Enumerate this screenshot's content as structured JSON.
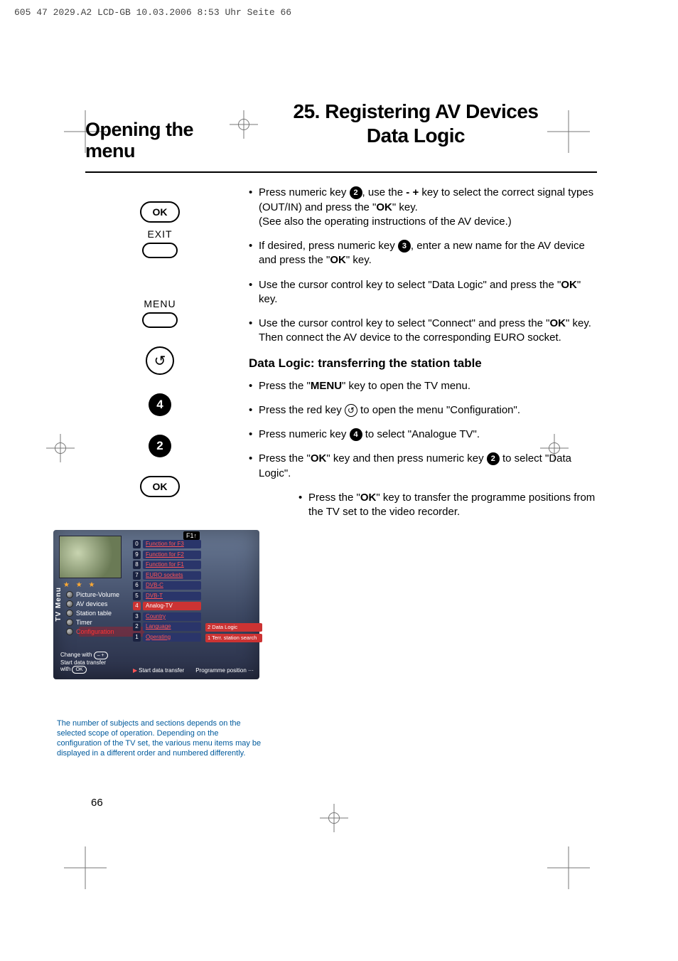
{
  "meta": {
    "header_line": "605 47 2029.A2 LCD-GB  10.03.2006  8:53 Uhr  Seite 66",
    "page_number": "66"
  },
  "titles": {
    "left": "Opening the menu",
    "right_line1": "25. Registering AV Devices",
    "right_line2": "Data Logic"
  },
  "remote": {
    "ok": "OK",
    "exit": "EXIT",
    "menu": "MENU",
    "back_glyph": "↺",
    "num4": "4",
    "num2": "2"
  },
  "body": {
    "b1_a": "Press numeric key ",
    "b1_b": ", use the ",
    "b1_minus": "-",
    "b1_plus": "+",
    "b1_c": " key to select the correct signal types (OUT/IN) and press the \"",
    "b1_ok": "OK",
    "b1_d": "\" key.",
    "b1_e": "(See also the operating instructions of the AV device.)",
    "b2_a": "If desired, press numeric key ",
    "b2_b": ", enter a new name for the AV device and press the \"",
    "b2_ok": "OK",
    "b2_c": "\" key.",
    "b3_a": "Use the cursor control key to select  \"Data Logic\" and press the \"",
    "b3_ok": "OK",
    "b3_b": "\" key.",
    "b4_a": "Use the cursor control key to select \"Connect\" and press the \"",
    "b4_ok": "OK",
    "b4_b": "\" key. Then connect the AV device to the corresponding EURO socket.",
    "subhead": "Data Logic: transferring the station table",
    "b5_a": "Press the \"",
    "b5_menu": "MENU",
    "b5_b": "\" key to open the TV menu.",
    "b6_a": "Press the red key ",
    "b6_b": " to open the menu \"Configuration\".",
    "b7_a": "Press numeric key ",
    "b7_b": " to select \"Analogue TV\".",
    "b8_a": "Press the \"",
    "b8_ok": "OK",
    "b8_b": "\" key and then press numeric key ",
    "b8_c": " to select \"Data Logic\".",
    "b9_a": "Press the \"",
    "b9_ok": "OK",
    "b9_b": "\" key to transfer the programme positions from the TV set to the video recorder."
  },
  "inline_nums": {
    "n2": "2",
    "n3": "3",
    "n4": "4"
  },
  "osd": {
    "f1": "F1↑",
    "side_label": "TV Menu",
    "stars": "★ ★ ★",
    "left_items": [
      "Picture-Volume",
      "AV devices",
      "Station table",
      "Timer",
      "Configuration"
    ],
    "numbers": [
      "0",
      "9",
      "8",
      "7",
      "6",
      "5",
      "4",
      "3",
      "2",
      "1"
    ],
    "mid_items": [
      "Function for F3",
      "Function for F2",
      "Function for F1",
      "EURO sockets",
      "DVB-C",
      "DVB-T",
      "Analog-TV",
      "Country",
      "Language",
      "Operating"
    ],
    "mid_selected_index": 6,
    "right_items": [
      "2 Data Logic",
      "1 Terr. station search"
    ],
    "hint_line1": "Change with ",
    "hint_line2": "Start data transfer",
    "hint_line3_prefix": "with ",
    "hint_ok": "OK",
    "bottom_left": "Start data transfer",
    "bottom_right": "Programme position ···"
  },
  "footnote": "The number of subjects and sections depends on the selected scope of operation. Depending on the configuration of the TV set, the various menu items may be displayed in a different order and numbered differently."
}
